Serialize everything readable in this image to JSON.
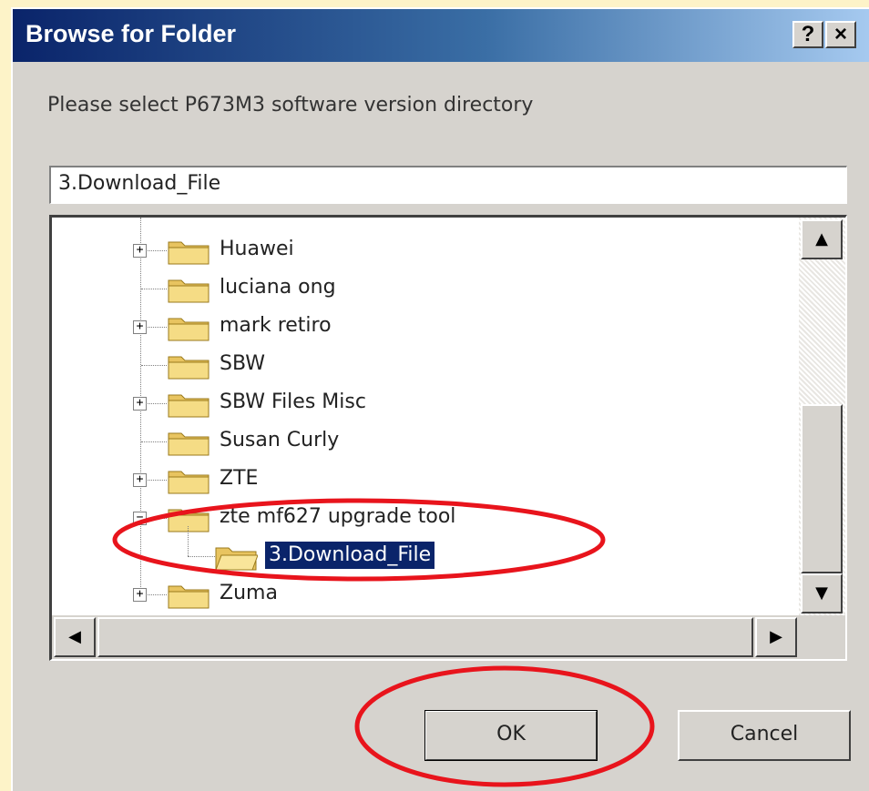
{
  "window": {
    "title": "Browse for Folder",
    "help_label": "?",
    "close_label": "×"
  },
  "prompt": "Please select P673M3 software version directory",
  "path_value": "3.Download_File",
  "tree": {
    "items": [
      {
        "label": "Huawei",
        "expander": "+"
      },
      {
        "label": "luciana ong",
        "expander": ""
      },
      {
        "label": "mark retiro",
        "expander": "+"
      },
      {
        "label": "SBW",
        "expander": ""
      },
      {
        "label": "SBW Files Misc",
        "expander": "+"
      },
      {
        "label": "Susan Curly",
        "expander": ""
      },
      {
        "label": "ZTE",
        "expander": "+"
      },
      {
        "label": "zte mf627 upgrade tool",
        "expander": "−"
      },
      {
        "label": "3.Download_File",
        "selected": true,
        "child": true
      },
      {
        "label": "Zuma",
        "expander": "+"
      }
    ]
  },
  "scrollbars": {
    "up_arrow": "▲",
    "down_arrow": "▼",
    "left_arrow": "◀",
    "right_arrow": "▶"
  },
  "buttons": {
    "ok": "OK",
    "cancel": "Cancel"
  },
  "colors": {
    "title_bar": "#0a246a",
    "dialog_face": "#d6d3ce",
    "selection": "#0a246a",
    "annotation": "#e8141c"
  },
  "icons": {
    "folder": "folder-icon"
  }
}
